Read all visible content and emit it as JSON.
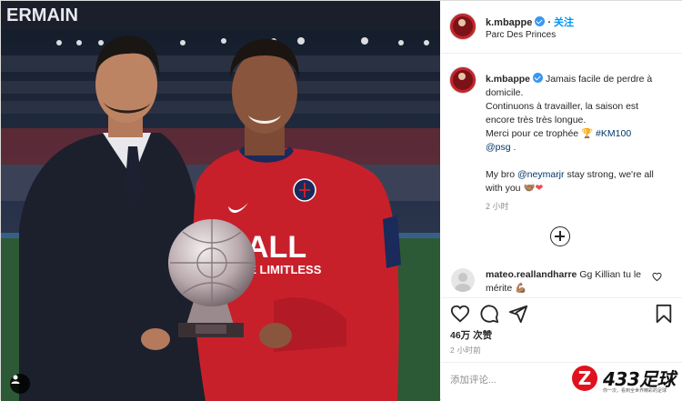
{
  "post": {
    "username": "k.mbappe",
    "follow_label": "关注",
    "location": "Parc Des Princes"
  },
  "photo": {
    "stadium_text": "ERMAIN",
    "jersey_sponsor": "ALL",
    "jersey_sponsor_sub": "LIVE LIMITLESS",
    "trophy_plate": "",
    "user_tag_icon": "user-tag-icon"
  },
  "caption": {
    "username": "k.mbappe",
    "line1": "Jamais facile de perdre à domicile.",
    "line2": "Continuons à travailler, la saison est encore très très longue.",
    "line3_prefix": "Merci pour ce trophée ",
    "line3_emoji": "🏆",
    "line3_hashtag": " #KM100",
    "line4": "@psg .",
    "line5_prefix": "My bro ",
    "line5_mention": "@neymarjr",
    "line5_suffix": " stay strong, we're all with you ",
    "line5_emoji": "🤝🏽❤",
    "time": "2 小时"
  },
  "comment2": {
    "username": "mateo.reallandharre",
    "text": "Gg Killian tu le mérite",
    "emoji": "💪🏽"
  },
  "actions": {
    "like_icon": "heart-icon",
    "comment_icon": "comment-icon",
    "share_icon": "share-icon",
    "save_icon": "bookmark-icon"
  },
  "likes": "46万 次赞",
  "post_time": "2 小时前",
  "add_comment": {
    "placeholder": "添加评论..."
  },
  "watermark": {
    "logo_letter": "Z",
    "title": "433足球",
    "subtitle": "你一次，看到全世界精彩的足球"
  },
  "colors": {
    "psg_red": "#c8202b",
    "psg_navy": "#1a2a5a",
    "link_blue": "#0095f6",
    "verified_blue": "#3897f0"
  }
}
